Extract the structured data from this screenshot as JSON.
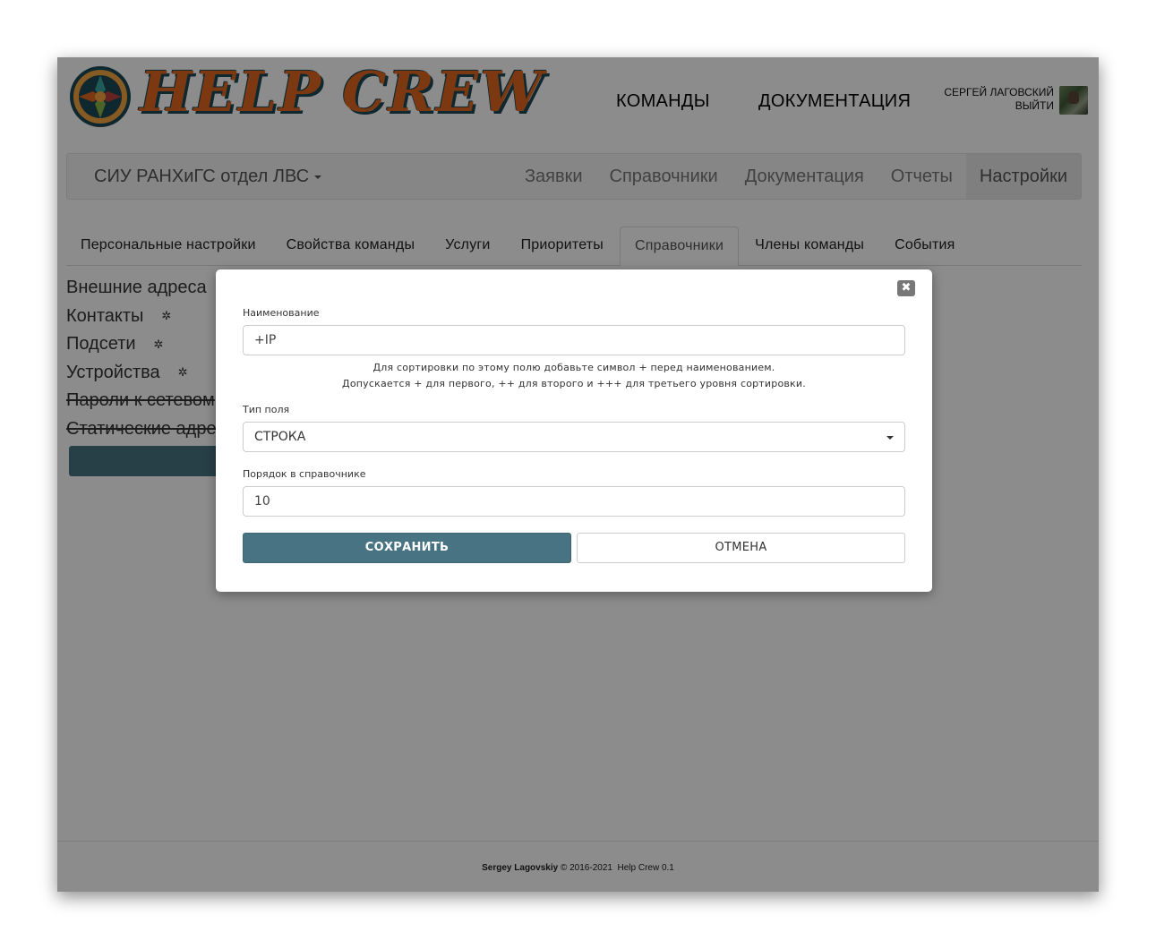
{
  "header": {
    "logo_text_1": "HELP",
    "logo_text_2": "CREW",
    "nav": {
      "teams": "КОМАНДЫ",
      "docs": "ДОКУМЕНТАЦИЯ"
    },
    "user_name": "СЕРГЕЙ ЛАГОВСКИЙ",
    "logout": "ВЫЙТИ"
  },
  "navbar": {
    "team": "СИУ РАНХиГС отдел ЛВС",
    "items": [
      "Заявки",
      "Справочники",
      "Документация",
      "Отчеты",
      "Настройки"
    ],
    "active": "Настройки"
  },
  "tabs": [
    "Персональные настройки",
    "Свойства команды",
    "Услуги",
    "Приоритеты",
    "Справочники",
    "Члены команды",
    "События"
  ],
  "active_tab": "Справочники",
  "dictionaries": [
    {
      "label": "Внешние адреса",
      "gear": false,
      "struck": false
    },
    {
      "label": "Контакты",
      "gear": true,
      "struck": false
    },
    {
      "label": "Подсети",
      "gear": true,
      "struck": false
    },
    {
      "label": "Устройства",
      "gear": true,
      "struck": false
    },
    {
      "label": "Пароли к сетевом",
      "gear": false,
      "struck": true
    },
    {
      "label": "Статические адре",
      "gear": false,
      "struck": true
    }
  ],
  "modal": {
    "close": "✖",
    "name_label": "Наименование",
    "name_value": "+IP",
    "help_line1": "Для сортировки по этому полю добавьте символ + перед наименованием.",
    "help_line2": "Допускается + для первого, ++ для второго и +++ для третьего уровня сортировки.",
    "type_label": "Тип поля",
    "type_value": "СТРОКА",
    "order_label": "Порядок в справочнике",
    "order_value": "10",
    "save": "СОХРАНИТЬ",
    "cancel": "ОТМЕНА"
  },
  "footer": {
    "author": "Sergey Lagovskiy",
    "copyright": "© 2016-2021",
    "version": "Help Crew 0.1"
  },
  "colors": {
    "accent": "#487382",
    "logo_orange": "#e1661f",
    "logo_dark": "#1d4a57",
    "overlay": "rgba(0,0,0,0.45)"
  }
}
